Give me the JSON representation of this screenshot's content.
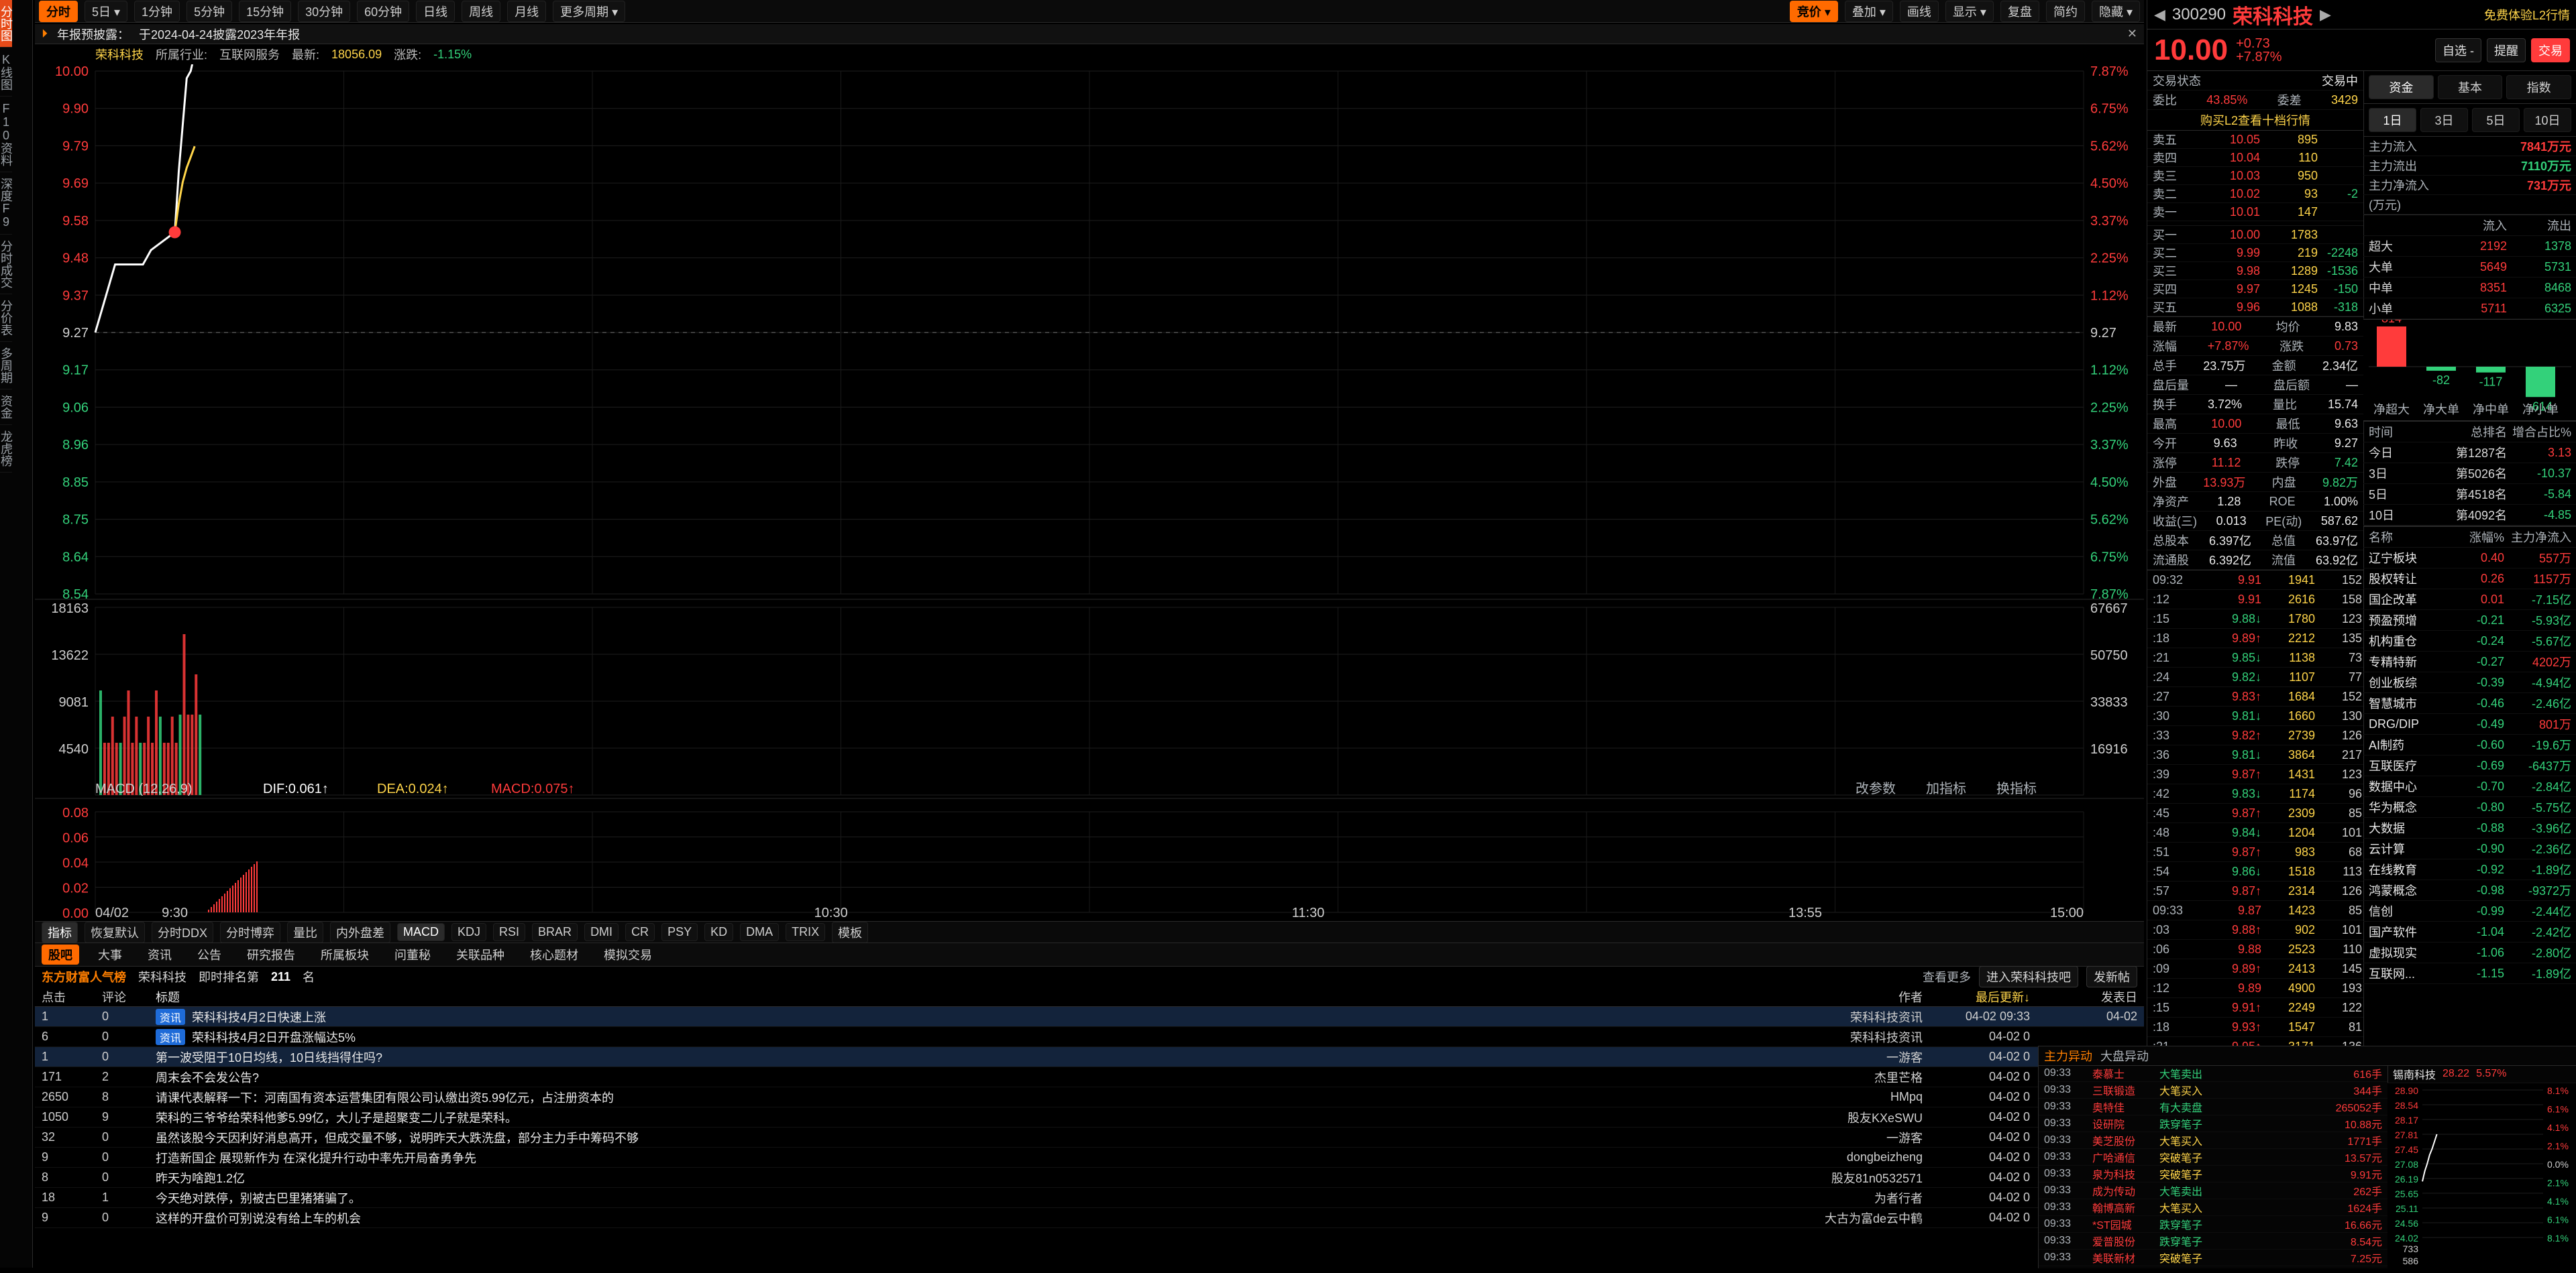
{
  "sidebar": {
    "items": [
      {
        "label": "分时图",
        "active": true
      },
      {
        "label": "K线图",
        "active": false
      },
      {
        "label": "F10资料",
        "active": false
      },
      {
        "label": "深度F9",
        "active": false
      },
      {
        "label": "分时成交",
        "active": false
      },
      {
        "label": "分价表",
        "active": false
      },
      {
        "label": "多周期",
        "active": false
      },
      {
        "label": "资金",
        "active": false
      },
      {
        "label": "龙虎榜",
        "active": false
      }
    ]
  },
  "toolbar": {
    "left": [
      {
        "label": "分时",
        "active": true
      },
      {
        "label": "5日 ▾"
      },
      {
        "label": "1分钟"
      },
      {
        "label": "5分钟"
      },
      {
        "label": "15分钟"
      },
      {
        "label": "30分钟"
      },
      {
        "label": "60分钟"
      },
      {
        "label": "日线"
      },
      {
        "label": "周线"
      },
      {
        "label": "月线"
      },
      {
        "label": "更多周期 ▾"
      }
    ],
    "right": [
      {
        "label": "竞价 ▾",
        "active": true
      },
      {
        "label": "叠加 ▾"
      },
      {
        "label": "画线"
      },
      {
        "label": "显示 ▾"
      },
      {
        "label": "复盘"
      },
      {
        "label": "简约"
      },
      {
        "label": "隐藏 ▾"
      }
    ]
  },
  "banner": {
    "prefix": "年报预披露：",
    "text": "于2024-04-24披露2023年年报"
  },
  "info": {
    "stock": "荣科科技",
    "industry_label": "所属行业:",
    "industry": "互联网服务",
    "latest_label": "最新:",
    "latest": "18056.09",
    "chg_label": "涨跌:",
    "chg": "-1.15%"
  },
  "chart_data": {
    "type": "line",
    "price_axis": {
      "left_ticks": [
        "10.00",
        "9.90",
        "9.79",
        "9.69",
        "9.58",
        "9.48",
        "9.37",
        "9.27",
        "9.17",
        "9.06",
        "8.96",
        "8.85",
        "8.75",
        "8.64",
        "8.54"
      ],
      "right_ticks": [
        "7.87%",
        "6.75%",
        "5.62%",
        "4.50%",
        "3.37%",
        "2.25%",
        "1.12%",
        "9.27",
        "1.12%",
        "2.25%",
        "3.37%",
        "4.50%",
        "5.62%",
        "6.75%",
        "7.87%"
      ]
    },
    "time_labels": [
      "04/02",
      "9:30",
      "10:30",
      "11:30",
      "13:55",
      "15:00"
    ],
    "price_series": {
      "x": [
        "9:15",
        "9:20",
        "9:25",
        "9:26",
        "9:27",
        "9:28",
        "9:29",
        "9:30",
        "9:31",
        "9:32",
        "9:33",
        "9:34",
        "9:35"
      ],
      "y": [
        9.27,
        9.46,
        9.46,
        9.46,
        9.46,
        9.48,
        9.5,
        9.55,
        9.72,
        9.85,
        9.98,
        10.0,
        10.05
      ]
    },
    "avg_series": {
      "x": [
        "9:30",
        "9:31",
        "9:32",
        "9:33",
        "9:34",
        "9:35"
      ],
      "y": [
        9.55,
        9.63,
        9.69,
        9.73,
        9.76,
        9.79
      ]
    },
    "volume_axis": {
      "left_ticks": [
        "18163",
        "13622",
        "9081",
        "4540"
      ],
      "right_ticks": [
        "67667",
        "50750",
        "33833",
        "16916"
      ]
    },
    "macd": {
      "label": "MACD (12,26,9)",
      "dif": "DIF:0.061↑",
      "dea": "DEA:0.024↑",
      "macd": "MACD:0.075↑",
      "left_ticks": [
        "0.08",
        "0.06",
        "0.04",
        "0.02",
        "0.00"
      ],
      "right_buttons": [
        "改参数",
        "加指标",
        "换指标"
      ]
    }
  },
  "chart_tabs": [
    "指标",
    "恢复默认",
    "分时DDX",
    "分时博弈",
    "量比",
    "内外盘差",
    "MACD",
    "KDJ",
    "RSI",
    "BRAR",
    "DMI",
    "CR",
    "PSY",
    "KD",
    "DMA",
    "TRIX",
    "模板"
  ],
  "news": {
    "tabs": [
      "股吧",
      "大事",
      "资讯",
      "公告",
      "研究报告",
      "所属板块",
      "问董秘",
      "关联品种",
      "核心题材",
      "模拟交易"
    ],
    "header": {
      "brand": "东方财富人气榜",
      "stock": "荣科科技",
      "rank_label": "即时排名第",
      "rank": "211",
      "rank_suffix": "名",
      "more": "查看更多",
      "btn1": "进入荣科科技吧",
      "btn2": "发新帖"
    },
    "cols": {
      "click": "点击",
      "comment": "评论",
      "title": "标题",
      "author": "作者",
      "updated": "最后更新↓",
      "posted": "发表日"
    },
    "rows": [
      {
        "click": "1",
        "comment": "0",
        "tag": "资讯",
        "title": "荣科科技4月2日快速上涨",
        "author": "荣科科技资讯",
        "updated": "04-02 09:33",
        "posted": "04-02",
        "highlight": true
      },
      {
        "click": "6",
        "comment": "0",
        "tag": "资讯",
        "title": "荣科科技4月2日开盘涨幅达5%",
        "author": "荣科科技资讯",
        "updated": "04-02 0",
        "posted": "",
        "highlight": false
      },
      {
        "click": "1",
        "comment": "0",
        "tag": "",
        "title": "第一波受阻于10日均线，10日线挡得住吗?",
        "author": "一游客",
        "updated": "04-02 0",
        "posted": "",
        "highlight": true
      },
      {
        "click": "171",
        "comment": "2",
        "tag": "",
        "title": "周末会不会发公告?",
        "author": "杰里芒格",
        "updated": "04-02 0",
        "posted": "",
        "highlight": false
      },
      {
        "click": "2650",
        "comment": "8",
        "tag": "",
        "title": "请课代表解释一下：河南国有资本运营集团有限公司认缴出资5.99亿元，占注册资本的",
        "author": "HMpq",
        "updated": "04-02 0",
        "posted": "",
        "highlight": false
      },
      {
        "click": "1050",
        "comment": "9",
        "tag": "",
        "title": "荣科的三爷爷给荣科他爹5.99亿，大儿子是超聚变二儿子就是荣科。",
        "author": "股友KXeSWU",
        "updated": "04-02 0",
        "posted": "",
        "highlight": false
      },
      {
        "click": "32",
        "comment": "0",
        "tag": "",
        "title": "虽然该股今天因利好消息高开，但成交量不够，说明昨天大跌洗盘，部分主力手中筹码不够",
        "author": "一游客",
        "updated": "04-02 0",
        "posted": "",
        "highlight": false
      },
      {
        "click": "9",
        "comment": "0",
        "tag": "",
        "title": "打造新国企 展现新作为 在深化提升行动中率先开局奋勇争先",
        "author": "dongbeizheng",
        "updated": "04-02 0",
        "posted": "",
        "highlight": false
      },
      {
        "click": "8",
        "comment": "0",
        "tag": "",
        "title": "昨天为啥跑1.2亿",
        "author": "股友81n0532571",
        "updated": "04-02 0",
        "posted": "",
        "highlight": false
      },
      {
        "click": "18",
        "comment": "1",
        "tag": "",
        "title": "今天绝对跌停，别被古巴里猪猪骗了。",
        "author": "为者行者",
        "updated": "04-02 0",
        "posted": "",
        "highlight": false
      },
      {
        "click": "9",
        "comment": "0",
        "tag": "",
        "title": "这样的开盘价可别说没有给上车的机会",
        "author": "大古为富de云中鹤",
        "updated": "04-02 0",
        "posted": "",
        "highlight": false
      }
    ]
  },
  "right": {
    "code": "300290",
    "name": "荣科科技",
    "l2": "免费体验L2行情",
    "price": "10.00",
    "chg": "+0.73",
    "pct": "+7.87%",
    "buttons": {
      "self": "自选 -",
      "alert": "提醒",
      "trade": "交易"
    },
    "status": {
      "k": "交易状态",
      "v": "交易中"
    },
    "ratio": {
      "k1": "委比",
      "v1": "43.85%",
      "k2": "委差",
      "v2": "3429"
    },
    "l2_title": "购买L2查看十档行情",
    "orderbook": {
      "asks": [
        {
          "lbl": "卖五",
          "p": "10.05",
          "q": "895",
          "d": ""
        },
        {
          "lbl": "卖四",
          "p": "10.04",
          "q": "110",
          "d": ""
        },
        {
          "lbl": "卖三",
          "p": "10.03",
          "q": "950",
          "d": ""
        },
        {
          "lbl": "卖二",
          "p": "10.02",
          "q": "93",
          "d": "-2"
        },
        {
          "lbl": "卖一",
          "p": "10.01",
          "q": "147",
          "d": ""
        }
      ],
      "bids": [
        {
          "lbl": "买一",
          "p": "10.00",
          "q": "1783",
          "d": ""
        },
        {
          "lbl": "买二",
          "p": "9.99",
          "q": "219",
          "d": "-2248"
        },
        {
          "lbl": "买三",
          "p": "9.98",
          "q": "1289",
          "d": "-1536"
        },
        {
          "lbl": "买四",
          "p": "9.97",
          "q": "1245",
          "d": "-150"
        },
        {
          "lbl": "买五",
          "p": "9.96",
          "q": "1088",
          "d": "-318"
        }
      ]
    },
    "stats": [
      {
        "k": "最新",
        "v": "10.00",
        "k2": "均价",
        "v2": "9.83"
      },
      {
        "k": "涨幅",
        "v": "+7.87%",
        "k2": "涨跌",
        "v2": "0.73"
      },
      {
        "k": "总手",
        "v": "23.75万",
        "k2": "金额",
        "v2": "2.34亿"
      },
      {
        "k": "盘后量",
        "v": "—",
        "k2": "盘后额",
        "v2": "—"
      },
      {
        "k": "换手",
        "v": "3.72%",
        "k2": "量比",
        "v2": "15.74"
      },
      {
        "k": "最高",
        "v": "10.00",
        "k2": "最低",
        "v2": "9.63"
      },
      {
        "k": "今开",
        "v": "9.63",
        "k2": "昨收",
        "v2": "9.27"
      },
      {
        "k": "涨停",
        "v": "11.12",
        "k2": "跌停",
        "v2": "7.42"
      },
      {
        "k": "外盘",
        "v": "13.93万",
        "k2": "内盘",
        "v2": "9.82万"
      },
      {
        "k": "净资产",
        "v": "1.28",
        "k2": "ROE",
        "v2": "1.00%"
      },
      {
        "k": "收益(三)",
        "v": "0.013",
        "k2": "PE(动)",
        "v2": "587.62"
      },
      {
        "k": "总股本",
        "v": "6.397亿",
        "k2": "总值",
        "v2": "63.97亿"
      },
      {
        "k": "流通股",
        "v": "6.392亿",
        "k2": "流值",
        "v2": "63.92亿"
      }
    ],
    "trades": [
      {
        "t": "09:32",
        "p": "9.91",
        "v": "1941",
        "n": "152"
      },
      {
        "t": ":12",
        "p": "9.91",
        "v": "2616",
        "n": "158"
      },
      {
        "t": ":15",
        "p": "9.88↓",
        "v": "1780",
        "n": "123"
      },
      {
        "t": ":18",
        "p": "9.89↑",
        "v": "2212",
        "n": "135"
      },
      {
        "t": ":21",
        "p": "9.85↓",
        "v": "1138",
        "n": "73"
      },
      {
        "t": ":24",
        "p": "9.82↓",
        "v": "1107",
        "n": "77"
      },
      {
        "t": ":27",
        "p": "9.83↑",
        "v": "1684",
        "n": "152"
      },
      {
        "t": ":30",
        "p": "9.81↓",
        "v": "1660",
        "n": "130"
      },
      {
        "t": ":33",
        "p": "9.82↑",
        "v": "2739",
        "n": "126"
      },
      {
        "t": ":36",
        "p": "9.81↓",
        "v": "3864",
        "n": "217"
      },
      {
        "t": ":39",
        "p": "9.87↑",
        "v": "1431",
        "n": "123"
      },
      {
        "t": ":42",
        "p": "9.83↓",
        "v": "1174",
        "n": "96"
      },
      {
        "t": ":45",
        "p": "9.87↑",
        "v": "2309",
        "n": "85"
      },
      {
        "t": ":48",
        "p": "9.84↓",
        "v": "1204",
        "n": "101"
      },
      {
        "t": ":51",
        "p": "9.87↑",
        "v": "983",
        "n": "68"
      },
      {
        "t": ":54",
        "p": "9.86↓",
        "v": "1518",
        "n": "113"
      },
      {
        "t": ":57",
        "p": "9.87↑",
        "v": "2314",
        "n": "126"
      },
      {
        "t": "09:33",
        "p": "9.87",
        "v": "1423",
        "n": "85"
      },
      {
        "t": ":03",
        "p": "9.88↑",
        "v": "902",
        "n": "101"
      },
      {
        "t": ":06",
        "p": "9.88",
        "v": "2523",
        "n": "110"
      },
      {
        "t": ":09",
        "p": "9.89↑",
        "v": "2413",
        "n": "145"
      },
      {
        "t": ":12",
        "p": "9.89",
        "v": "4900",
        "n": "193"
      },
      {
        "t": ":15",
        "p": "9.91↑",
        "v": "2249",
        "n": "122"
      },
      {
        "t": ":18",
        "p": "9.93↑",
        "v": "1547",
        "n": "81"
      },
      {
        "t": ":21",
        "p": "9.95↑",
        "v": "3171",
        "n": "136"
      }
    ],
    "fund_tabs": [
      "资金",
      "基本",
      "指数"
    ],
    "period_tabs": [
      "1日",
      "3日",
      "5日",
      "10日"
    ],
    "flows": [
      {
        "k": "主力流入",
        "v": "7841",
        "u": "万元",
        "cls": "red"
      },
      {
        "k": "主力流出",
        "v": "7110",
        "u": "万元",
        "cls": "green"
      },
      {
        "k": "主力净流入",
        "v": "731",
        "u": "万元",
        "cls": "red"
      }
    ],
    "flows_unit": "(万元)",
    "flow_table": {
      "head": [
        "",
        "流入",
        "流出"
      ],
      "rows": [
        {
          "n": "超大",
          "in": "2192",
          "out": "1378"
        },
        {
          "n": "大单",
          "in": "5649",
          "out": "5731"
        },
        {
          "n": "中单",
          "in": "8351",
          "out": "8468"
        },
        {
          "n": "小单",
          "in": "5711",
          "out": "6325"
        }
      ]
    },
    "net_bars": {
      "labels": [
        "净超大",
        "净大单",
        "净中单",
        "净小单"
      ],
      "values": [
        "814",
        "-82",
        "-117",
        "-614"
      ]
    },
    "rank": {
      "head": [
        "时间",
        "总排名",
        "增合占比%"
      ],
      "rows": [
        {
          "t": "今日",
          "r": "第1287名",
          "p": "3.13"
        },
        {
          "t": "3日",
          "r": "第5026名",
          "p": "-10.37"
        },
        {
          "t": "5日",
          "r": "第4518名",
          "p": "-5.84"
        },
        {
          "t": "10日",
          "r": "第4092名",
          "p": "-4.85"
        }
      ]
    },
    "sectors": {
      "head": [
        "名称",
        "涨幅%",
        "主力净流入"
      ],
      "rows": [
        {
          "name": "辽宁板块",
          "pct": "0.40",
          "flow": "557万"
        },
        {
          "name": "股权转让",
          "pct": "0.26",
          "flow": "1157万"
        },
        {
          "name": "国企改革",
          "pct": "0.01",
          "flow": "-7.15亿"
        },
        {
          "name": "预盈预增",
          "pct": "-0.21",
          "flow": "-5.93亿"
        },
        {
          "name": "机构重仓",
          "pct": "-0.24",
          "flow": "-5.67亿"
        },
        {
          "name": "专精特新",
          "pct": "-0.27",
          "flow": "4202万"
        },
        {
          "name": "创业板综",
          "pct": "-0.39",
          "flow": "-4.94亿"
        },
        {
          "name": "智慧城市",
          "pct": "-0.46",
          "flow": "-2.46亿"
        },
        {
          "name": "DRG/DIP",
          "pct": "-0.49",
          "flow": "801万"
        },
        {
          "name": "AI制药",
          "pct": "-0.60",
          "flow": "-19.6万"
        },
        {
          "name": "互联医疗",
          "pct": "-0.69",
          "flow": "-6437万"
        },
        {
          "name": "数据中心",
          "pct": "-0.70",
          "flow": "-2.84亿"
        },
        {
          "name": "华为概念",
          "pct": "-0.80",
          "flow": "-5.75亿"
        },
        {
          "name": "大数据",
          "pct": "-0.88",
          "flow": "-3.96亿"
        },
        {
          "name": "云计算",
          "pct": "-0.90",
          "flow": "-2.36亿"
        },
        {
          "name": "在线教育",
          "pct": "-0.92",
          "flow": "-1.89亿"
        },
        {
          "name": "鸿蒙概念",
          "pct": "-0.98",
          "flow": "-9372万"
        },
        {
          "name": "信创",
          "pct": "-0.99",
          "flow": "-2.44亿"
        },
        {
          "name": "国产软件",
          "pct": "-1.04",
          "flow": "-2.42亿"
        },
        {
          "name": "虚拟现实",
          "pct": "-1.06",
          "flow": "-2.80亿"
        },
        {
          "name": "互联网...",
          "pct": "-1.15",
          "flow": "-1.89亿"
        }
      ]
    }
  },
  "bottom_right": {
    "head": {
      "label": "主力异动",
      "right": "大盘异动"
    },
    "rows": [
      {
        "t": "09:33",
        "s": "泰慕士",
        "e": "大笔卖出",
        "val": "616手"
      },
      {
        "t": "09:33",
        "s": "三联锻造",
        "e": "大笔买入",
        "val": "344手"
      },
      {
        "t": "09:33",
        "s": "奥特佳",
        "e": "有大卖盘",
        "val": "265052手"
      },
      {
        "t": "09:33",
        "s": "设研院",
        "e": "跌穿笔子",
        "val": "10.88元"
      },
      {
        "t": "09:33",
        "s": "美芝股份",
        "e": "大笔买入",
        "val": "1771手"
      },
      {
        "t": "09:33",
        "s": "广哈通信",
        "e": "突破笔子",
        "val": "13.57元"
      },
      {
        "t": "09:33",
        "s": "泉为科技",
        "e": "突破笔子",
        "val": "9.91元"
      },
      {
        "t": "09:33",
        "s": "成为传动",
        "e": "大笔卖出",
        "val": "262手"
      },
      {
        "t": "09:33",
        "s": "翰博高新",
        "e": "大笔买入",
        "val": "1624手"
      },
      {
        "t": "09:33",
        "s": "*ST园城",
        "e": "跌穿笔子",
        "val": "16.66元"
      },
      {
        "t": "09:33",
        "s": "爱普股份",
        "e": "跌穿笔子",
        "val": "8.54元"
      },
      {
        "t": "09:33",
        "s": "美联新材",
        "e": "突破笔子",
        "val": "7.25元"
      }
    ],
    "mini": {
      "name": "锡南科技",
      "price": "28.22",
      "pct": "5.57%",
      "left_ticks": [
        "28.90",
        "28.54",
        "28.17",
        "27.81",
        "27.45",
        "27.08",
        "26.19",
        "25.65",
        "25.11",
        "24.56",
        "24.02"
      ],
      "right_ticks": [
        "8.1%",
        "6.1%",
        "4.1%",
        "2.1%",
        "0.0%",
        "2.1%",
        "4.1%",
        "6.1%",
        "8.1%"
      ],
      "vol": [
        "733",
        "586"
      ]
    }
  }
}
